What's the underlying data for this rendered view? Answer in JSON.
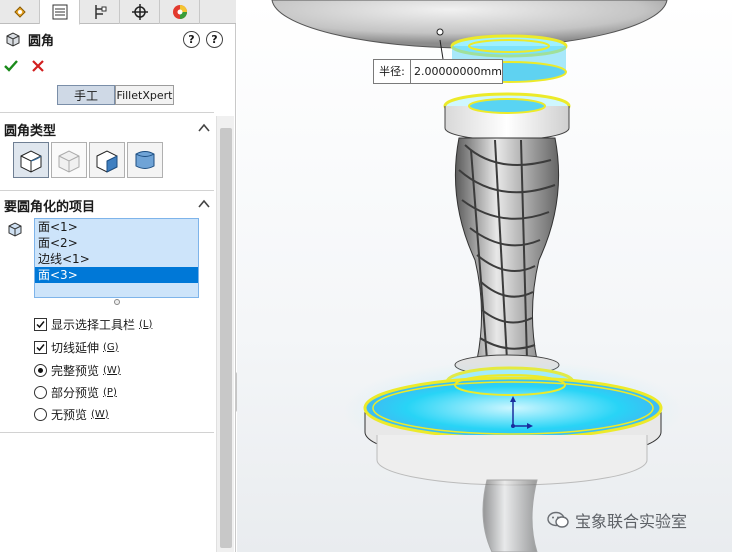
{
  "feature": {
    "title": "圆角"
  },
  "tabs": [
    "feature-manager-icon",
    "property-manager-icon",
    "configuration-manager-icon",
    "dimxpert-icon",
    "display-manager-icon"
  ],
  "mode_buttons": {
    "manual": "手工",
    "filletxpert": "FilletXpert"
  },
  "fillet_type": {
    "title": "圆角类型",
    "options": [
      "constant-radius-fillet-icon",
      "variable-radius-fillet-icon",
      "face-fillet-icon",
      "full-round-fillet-icon"
    ]
  },
  "items_to_fillet": {
    "title": "要圆角化的项目",
    "items": [
      "面<1>",
      "面<2>",
      "边线<1>",
      "面<3>"
    ],
    "selected_index": 3
  },
  "options": {
    "show_selection_toolbar": {
      "label": "显示选择工具栏",
      "key": "(L)",
      "checked": true
    },
    "tangent_propagation": {
      "label": "切线延伸",
      "key": "(G)",
      "checked": true
    },
    "full_preview": {
      "label": "完整预览",
      "key": "(W)",
      "selected": true
    },
    "partial_preview": {
      "label": "部分预览",
      "key": "(P)",
      "selected": false
    },
    "no_preview": {
      "label": "无预览",
      "key": "(W)",
      "selected": false
    }
  },
  "radius_callout": {
    "label": "半径:",
    "value": "2.00000000mm"
  },
  "watermark": {
    "text": "宝象联合实验室"
  },
  "colors": {
    "accent_blue": "#0078d7",
    "ok_green": "#1a8a1a",
    "cancel_red": "#d21f1f",
    "selection_yellow": "#f4f12a",
    "selection_cyan": "#19d4f4"
  }
}
